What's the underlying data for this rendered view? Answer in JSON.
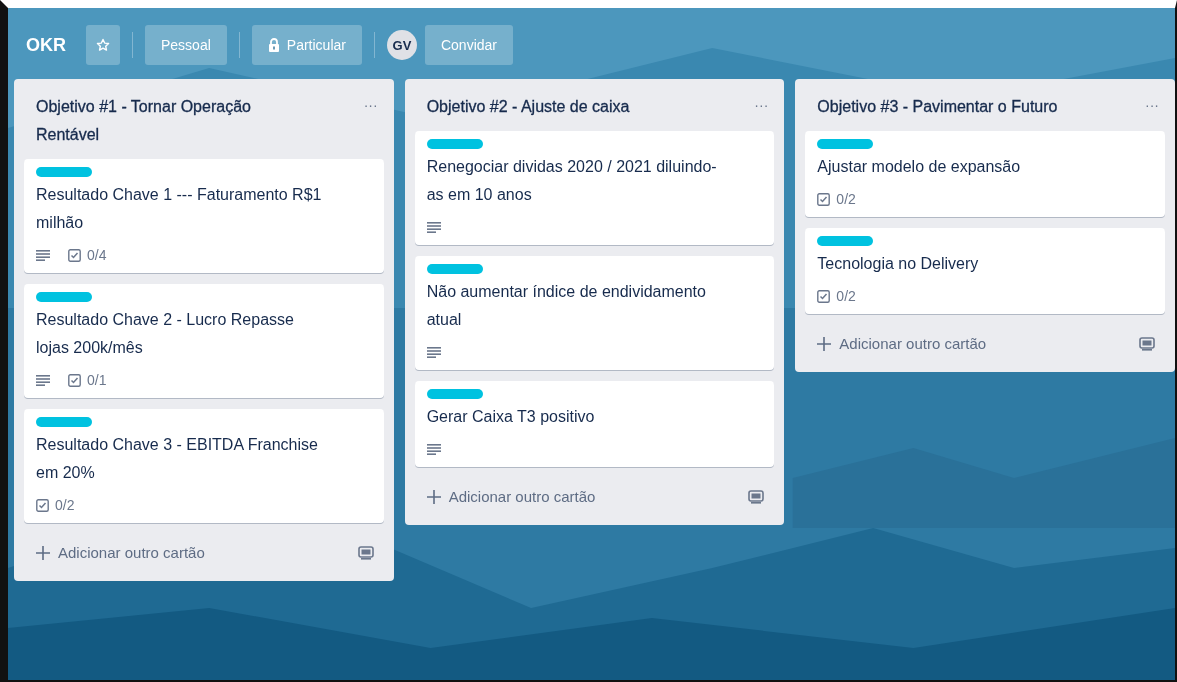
{
  "board": {
    "title": "OKR",
    "starred": false,
    "team": "Pessoal",
    "visibility": "Particular",
    "avatar": "GV",
    "invite": "Convidar"
  },
  "lists": [
    {
      "title": "Objetivo #1 - Tornar Operação Rentável",
      "menu": "···",
      "add": "Adicionar outro cartão",
      "cards": [
        {
          "color": "#00c2e0",
          "title": "Resultado Chave 1 --- Faturamento R$1 milhão",
          "description": true,
          "checklist": "0/4"
        },
        {
          "color": "#00c2e0",
          "title": "Resultado Chave 2 - Lucro Repasse lojas 200k/mês",
          "description": true,
          "checklist": "0/1"
        },
        {
          "color": "#00c2e0",
          "title": "Resultado Chave 3 - EBITDA Franchise em 20%",
          "description": false,
          "checklist": "0/2"
        }
      ]
    },
    {
      "title": "Objetivo #2 - Ajuste de caixa",
      "menu": "···",
      "add": "Adicionar outro cartão",
      "cards": [
        {
          "color": "#00c2e0",
          "title": "Renegociar dividas 2020 / 2021 diluindo-as em 10 anos",
          "description": true
        },
        {
          "color": "#00c2e0",
          "title": "Não aumentar índice de endividamento atual",
          "description": true
        },
        {
          "color": "#00c2e0",
          "title": "Gerar Caixa T3 positivo",
          "description": true
        }
      ]
    },
    {
      "title": "Objetivo #3 - Pavimentar o Futuro",
      "menu": "···",
      "add": "Adicionar outro cartão",
      "cards": [
        {
          "color": "#00c2e0",
          "title": "Ajustar modelo de expansão",
          "description": false,
          "checklist": "0/2"
        },
        {
          "color": "#00c2e0",
          "title": "Tecnologia no Delivery",
          "description": false,
          "checklist": "0/2"
        }
      ]
    }
  ]
}
